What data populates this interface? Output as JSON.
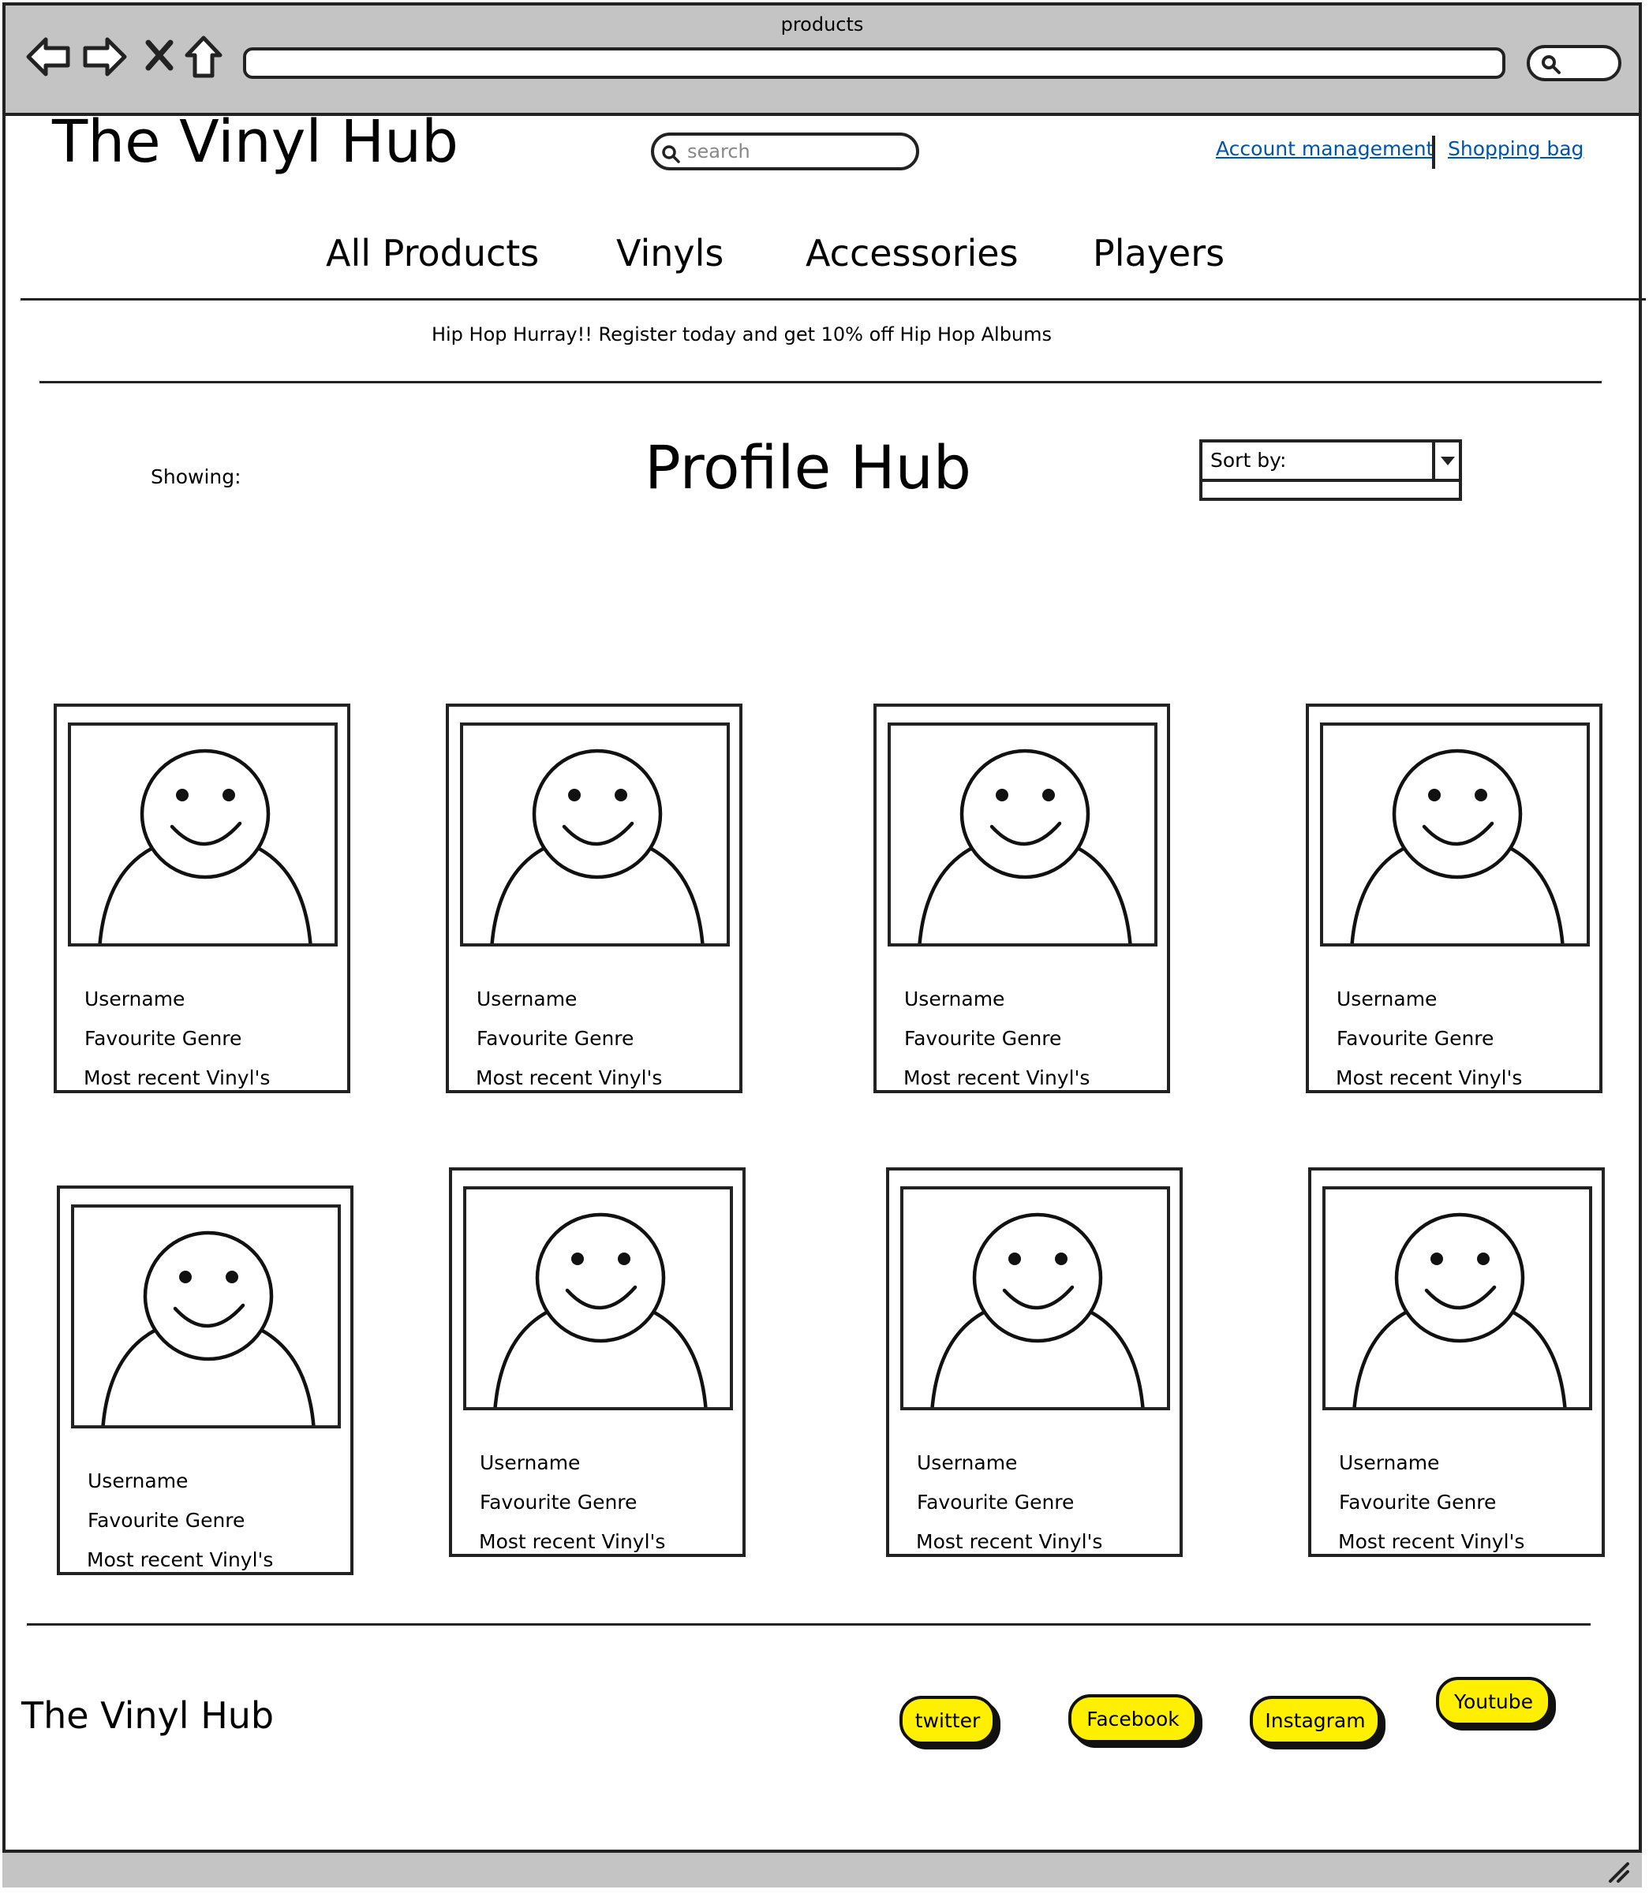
{
  "window": {
    "title": "products"
  },
  "header": {
    "logo": "The Vinyl Hub",
    "search_placeholder": "search",
    "links": {
      "account": "Account management",
      "bag": "Shopping bag"
    }
  },
  "nav": {
    "items": [
      "All Products",
      "Vinyls",
      "Accessories",
      "Players"
    ]
  },
  "promo": "Hip Hop Hurray!! Register today and get 10% off Hip Hop Albums",
  "main": {
    "showing": "Showing:",
    "title": "Profile Hub",
    "sort_label": "Sort by:"
  },
  "profiles": [
    {
      "username": "Username",
      "genre": "Favourite Genre",
      "recent": "Most recent Vinyl's"
    },
    {
      "username": "Username",
      "genre": "Favourite Genre",
      "recent": "Most recent Vinyl's"
    },
    {
      "username": "Username",
      "genre": "Favourite Genre",
      "recent": "Most recent Vinyl's"
    },
    {
      "username": "Username",
      "genre": "Favourite Genre",
      "recent": "Most recent Vinyl's"
    },
    {
      "username": "Username",
      "genre": "Favourite Genre",
      "recent": "Most recent Vinyl's"
    },
    {
      "username": "Username",
      "genre": "Favourite Genre",
      "recent": "Most recent Vinyl's"
    },
    {
      "username": "Username",
      "genre": "Favourite Genre",
      "recent": "Most recent Vinyl's"
    },
    {
      "username": "Username",
      "genre": "Favourite Genre",
      "recent": "Most recent Vinyl's"
    }
  ],
  "footer": {
    "logo": "The Vinyl Hub",
    "social": [
      "twitter",
      "Facebook",
      "Instagram",
      "Youtube"
    ]
  },
  "colors": {
    "chrome": "#c4c4c4",
    "link": "#0055aa",
    "social_button": "#ffef00"
  }
}
